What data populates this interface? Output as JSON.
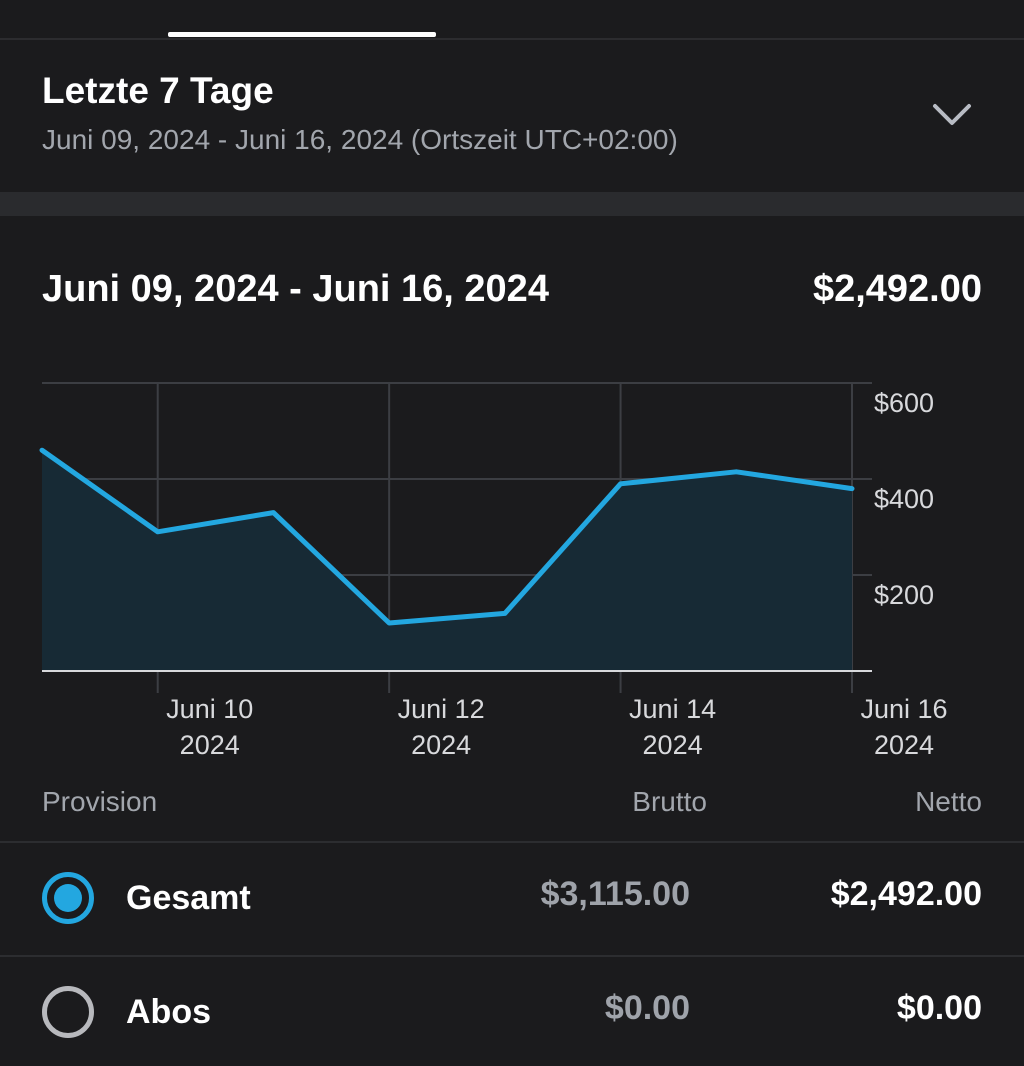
{
  "range": {
    "title": "Letzte 7 Tage",
    "subtitle": "Juni 09, 2024 - Juni 16, 2024 (Ortszeit UTC+02:00)",
    "icon": "chevron-down-icon"
  },
  "summary": {
    "period": "Juni 09, 2024 - Juni 16, 2024",
    "total": "$2,492.00"
  },
  "colors": {
    "line": "#23a7e0",
    "area": "#172a35",
    "grid": "#3c3e43"
  },
  "chart_data": {
    "type": "area",
    "x": [
      "2024-06-09",
      "2024-06-10",
      "2024-06-11",
      "2024-06-12",
      "2024-06-13",
      "2024-06-14",
      "2024-06-15",
      "2024-06-16"
    ],
    "values": [
      460,
      290,
      330,
      100,
      120,
      390,
      415,
      380
    ],
    "ylim": [
      0,
      600
    ],
    "y_ticks": [
      {
        "value": 600,
        "label": "$600"
      },
      {
        "value": 400,
        "label": "$400"
      },
      {
        "value": 200,
        "label": "$200"
      }
    ],
    "x_ticks": [
      {
        "index": 1,
        "line1": "Juni 10",
        "line2": "2024"
      },
      {
        "index": 3,
        "line1": "Juni 12",
        "line2": "2024"
      },
      {
        "index": 5,
        "line1": "Juni 14",
        "line2": "2024"
      },
      {
        "index": 7,
        "line1": "Juni 16",
        "line2": "2024"
      }
    ],
    "grid": true,
    "y_axis_position": "right"
  },
  "table": {
    "headers": {
      "provision": "Provision",
      "brutto": "Brutto",
      "netto": "Netto"
    },
    "rows": [
      {
        "label": "Gesamt",
        "brutto": "$3,115.00",
        "netto": "$2,492.00",
        "selected": true
      },
      {
        "label": "Abos",
        "brutto": "$0.00",
        "netto": "$0.00",
        "selected": false
      }
    ]
  }
}
